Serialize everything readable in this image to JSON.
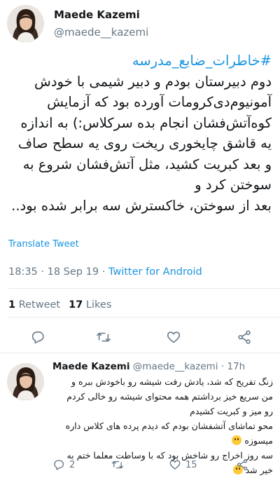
{
  "main_tweet": {
    "author_name": "Maede Kazemi",
    "author_handle": "@maede__kazemi",
    "hashtag": "#خاطرات_ضایع_مدرسه",
    "lines": [
      "دوم دبیرستان بودم و دبیر شیمی با خودش",
      "آمونیوم‌دی‌کرومات آورده بود که آزمایش",
      "کوه‌آتش‌فشان انجام بده سرکلاس:) به اندازه",
      "یه قاشق چایخوری ریخت روی یه سطح صاف",
      "و بعد کبریت کشید، مثل آتش‌فشان شروع به",
      "سوختن کرد و",
      "بعد از سوختن، خاکسترش سه برابر شده بود.."
    ],
    "translate_label": "Translate Tweet",
    "time": "18:35",
    "date": "18 Sep 19",
    "separator": "·",
    "client": "Twitter for Android",
    "retweet_count": "1",
    "retweet_label": "Retweet",
    "like_count": "17",
    "like_label": "Likes",
    "icons": [
      "reply-icon",
      "retweet-icon",
      "like-icon",
      "share-icon"
    ]
  },
  "reply_tweet": {
    "author_name": "Maede Kazemi",
    "author_handle": "@maede__kazemi",
    "separator": "·",
    "time": "17h",
    "lines": [
      "زنگ تفریح که شد، یادش رفت شیشه رو باخودش ببره و",
      "من سریع خیز برداشتم همه محتوای شیشه رو خالی کردم",
      "رو میز و کبریت کشیدم",
      "محو تماشای آتشفشان بودم که دیدم پرده های کلاس داره",
      "میسوزه",
      "سه روز اخراج رو شاخش بود که با وساطت معلما ختم به",
      "خیر شد"
    ],
    "reply_count": "2",
    "retweet_count": "",
    "like_count": "15",
    "colors": {
      "text": "#14171a",
      "muted": "#657786",
      "link": "#1b95e0",
      "divider": "#e6ecf0"
    }
  }
}
